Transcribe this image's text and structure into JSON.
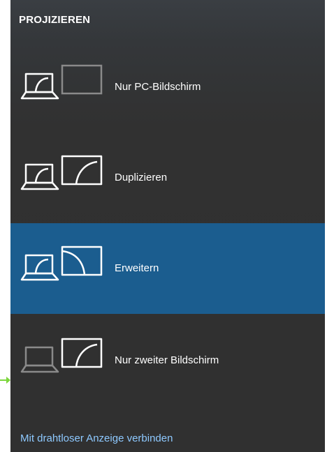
{
  "panel": {
    "title": "PROJIZIEREN",
    "options": [
      {
        "id": "pc-only",
        "label": "Nur PC-Bildschirm",
        "selected": false,
        "icon": "pc-screen-only-icon"
      },
      {
        "id": "duplicate",
        "label": "Duplizieren",
        "selected": false,
        "icon": "duplicate-icon"
      },
      {
        "id": "extend",
        "label": "Erweitern",
        "selected": true,
        "icon": "extend-icon"
      },
      {
        "id": "second-only",
        "label": "Nur zweiter Bildschirm",
        "selected": false,
        "icon": "second-screen-only-icon"
      }
    ],
    "wireless_link": "Mit drahtloser Anzeige verbinden"
  },
  "colors": {
    "panel_bg": "#313131",
    "selected_bg": "#1b5d8f",
    "link": "#8ec9ff",
    "dimmed_icon": "#8a8a8a",
    "pointer_arrow": "#7cd63c"
  }
}
